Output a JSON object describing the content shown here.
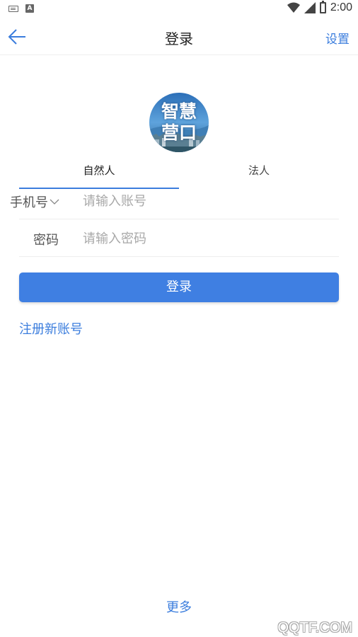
{
  "status_bar": {
    "left_icons": [
      "keyboard-icon",
      "a-icon"
    ],
    "time": "2:00",
    "right_icons": [
      "wifi-icon",
      "signal-icon",
      "battery-icon"
    ]
  },
  "nav": {
    "title": "登录",
    "settings_label": "设置",
    "back_icon": "arrow-left-icon"
  },
  "logo": {
    "line1": "智慧",
    "line2": "营口"
  },
  "tabs": [
    {
      "label": "自然人",
      "active": true
    },
    {
      "label": "法人",
      "active": false
    }
  ],
  "form": {
    "phone_label": "手机号",
    "account_placeholder": "请输入账号",
    "password_label": "密码",
    "password_placeholder": "请输入密码"
  },
  "login_button": "登录",
  "register_link": "注册新账号",
  "more_link": "更多",
  "watermark": "QQTF.COM",
  "colors": {
    "accent": "#3b7ddd",
    "button": "#3f7fe2",
    "divider": "#eeeeee"
  }
}
